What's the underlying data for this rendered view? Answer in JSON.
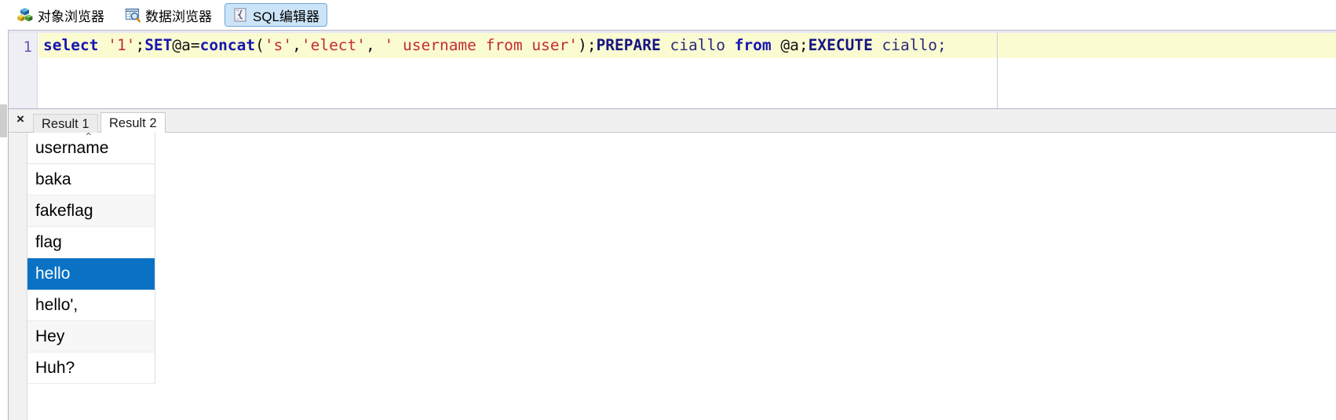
{
  "toolbar": {
    "tabs": [
      {
        "label": "对象浏览器",
        "icon": "cubes-icon",
        "active": false
      },
      {
        "label": "数据浏览器",
        "icon": "table-search-icon",
        "active": false
      },
      {
        "label": "SQL编辑器",
        "icon": "sql-script-icon",
        "active": true
      }
    ]
  },
  "editor": {
    "line_number": "1",
    "tokens": [
      {
        "text": "select",
        "type": "kw"
      },
      {
        "text": " ",
        "type": "plain"
      },
      {
        "text": "'1'",
        "type": "str"
      },
      {
        "text": ";",
        "type": "punct"
      },
      {
        "text": "SET",
        "type": "kw"
      },
      {
        "text": "@a",
        "type": "punct"
      },
      {
        "text": "=",
        "type": "punct"
      },
      {
        "text": "concat",
        "type": "kw"
      },
      {
        "text": "(",
        "type": "punct"
      },
      {
        "text": "'s'",
        "type": "str"
      },
      {
        "text": ",",
        "type": "punct"
      },
      {
        "text": "'elect'",
        "type": "str"
      },
      {
        "text": ", ",
        "type": "punct"
      },
      {
        "text": "' username from user'",
        "type": "str"
      },
      {
        "text": ")",
        "type": "punct"
      },
      {
        "text": ";",
        "type": "punct"
      },
      {
        "text": "PREPARE",
        "type": "navy"
      },
      {
        "text": " ciallo ",
        "type": "plain"
      },
      {
        "text": "from",
        "type": "kw"
      },
      {
        "text": " ",
        "type": "plain"
      },
      {
        "text": "@a",
        "type": "punct"
      },
      {
        "text": ";",
        "type": "punct"
      },
      {
        "text": "EXECUTE",
        "type": "navy"
      },
      {
        "text": " ciallo;",
        "type": "plain"
      }
    ],
    "full_text": "select '1';SET@a=concat('s','elect', ' username from user');PREPARE ciallo from @a;EXECUTE ciallo;"
  },
  "results": {
    "close_label": "×",
    "tabs": [
      {
        "label": "Result 1",
        "active": false
      },
      {
        "label": "Result 2",
        "active": true
      }
    ],
    "sort_caret": "⌃",
    "column_header": "username",
    "rows": [
      {
        "value": "baka",
        "selected": false
      },
      {
        "value": "fakeflag",
        "selected": false
      },
      {
        "value": "flag",
        "selected": false
      },
      {
        "value": "hello",
        "selected": true
      },
      {
        "value": "hello',",
        "selected": false
      },
      {
        "value": "Hey",
        "selected": false
      },
      {
        "value": "Huh?",
        "selected": false
      }
    ]
  },
  "colors": {
    "selection_blue": "#0a72c4",
    "active_tab_blue": "#cce4f7",
    "current_line_yellow": "#fbfbd2",
    "keyword_blue": "#1616b0",
    "string_red": "#c22f2f",
    "gutter_purple": "#6b54b0"
  }
}
